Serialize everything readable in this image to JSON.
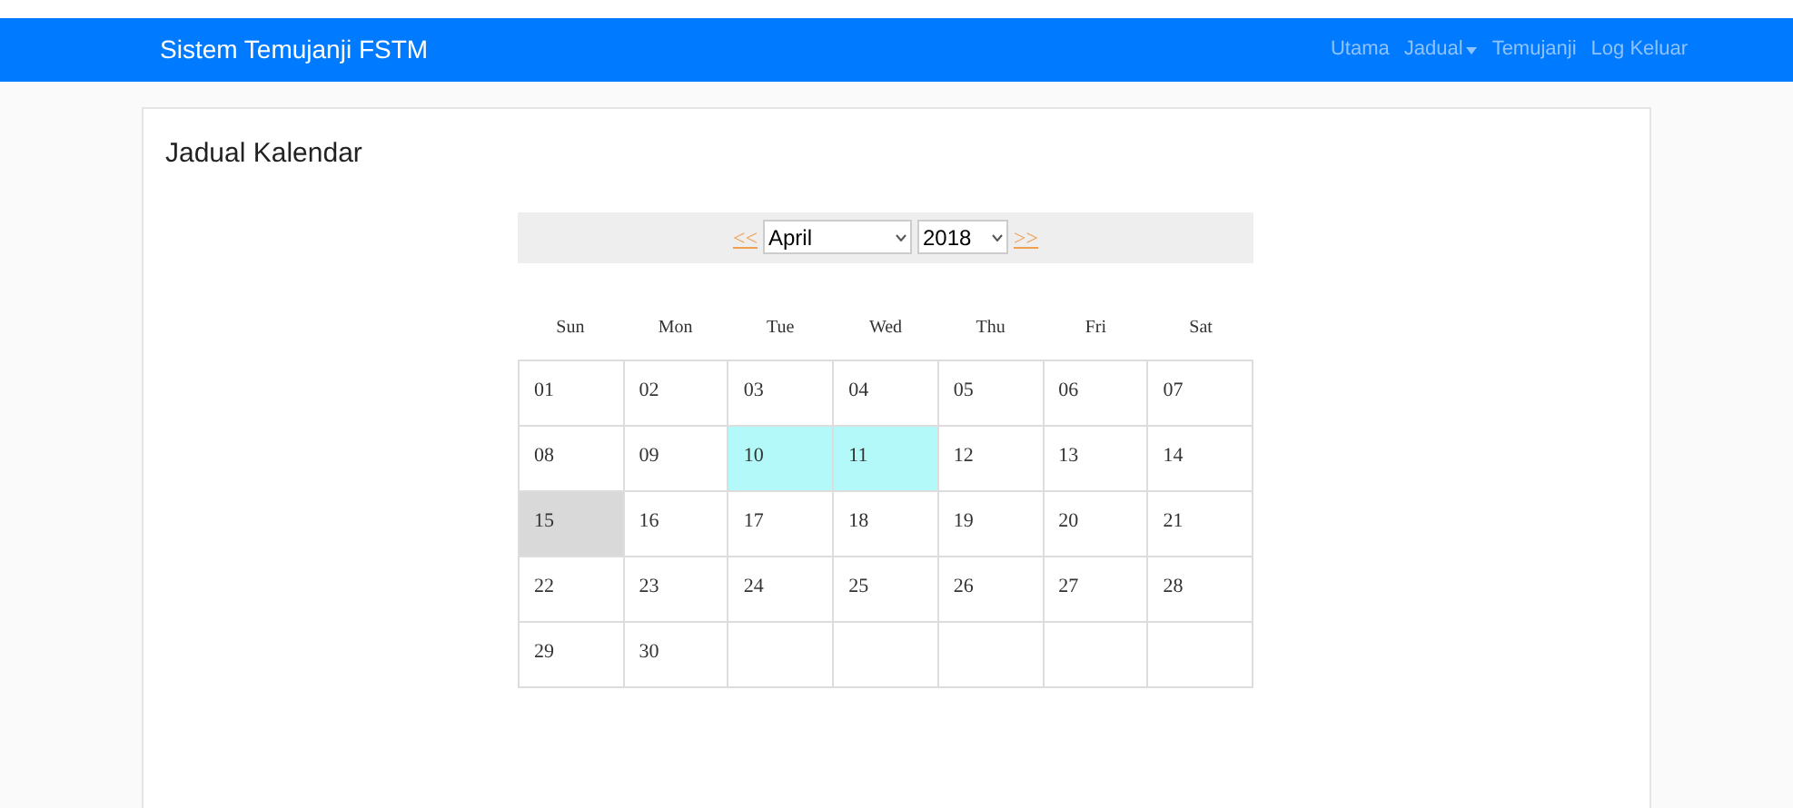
{
  "navbar": {
    "brand": "Sistem Temujanji FSTM",
    "links": [
      {
        "label": "Utama",
        "dropdown": false
      },
      {
        "label": "Jadual",
        "dropdown": true
      },
      {
        "label": "Temujanji",
        "dropdown": false
      },
      {
        "label": "Log Keluar",
        "dropdown": false
      }
    ]
  },
  "card": {
    "title": "Jadual Kalendar"
  },
  "calendar": {
    "prev": "<<",
    "month": "April",
    "year": "2018",
    "next": ">>",
    "weekdays": [
      "Sun",
      "Mon",
      "Tue",
      "Wed",
      "Thu",
      "Fri",
      "Sat"
    ],
    "weeks": [
      [
        {
          "day": "01",
          "kind": "normal"
        },
        {
          "day": "02",
          "kind": "normal"
        },
        {
          "day": "03",
          "kind": "normal"
        },
        {
          "day": "04",
          "kind": "normal"
        },
        {
          "day": "05",
          "kind": "normal"
        },
        {
          "day": "06",
          "kind": "normal"
        },
        {
          "day": "07",
          "kind": "normal"
        }
      ],
      [
        {
          "day": "08",
          "kind": "normal"
        },
        {
          "day": "09",
          "kind": "normal"
        },
        {
          "day": "10",
          "kind": "booked"
        },
        {
          "day": "11",
          "kind": "booked"
        },
        {
          "day": "12",
          "kind": "normal"
        },
        {
          "day": "13",
          "kind": "normal"
        },
        {
          "day": "14",
          "kind": "normal"
        }
      ],
      [
        {
          "day": "15",
          "kind": "today"
        },
        {
          "day": "16",
          "kind": "normal"
        },
        {
          "day": "17",
          "kind": "normal"
        },
        {
          "day": "18",
          "kind": "normal"
        },
        {
          "day": "19",
          "kind": "normal"
        },
        {
          "day": "20",
          "kind": "normal"
        },
        {
          "day": "21",
          "kind": "normal"
        }
      ],
      [
        {
          "day": "22",
          "kind": "normal"
        },
        {
          "day": "23",
          "kind": "normal"
        },
        {
          "day": "24",
          "kind": "normal"
        },
        {
          "day": "25",
          "kind": "normal"
        },
        {
          "day": "26",
          "kind": "normal"
        },
        {
          "day": "27",
          "kind": "normal"
        },
        {
          "day": "28",
          "kind": "normal"
        }
      ],
      [
        {
          "day": "29",
          "kind": "normal"
        },
        {
          "day": "30",
          "kind": "normal"
        },
        {
          "kind": "empty"
        },
        {
          "kind": "empty"
        },
        {
          "kind": "empty"
        },
        {
          "kind": "empty"
        },
        {
          "kind": "empty"
        }
      ]
    ]
  }
}
